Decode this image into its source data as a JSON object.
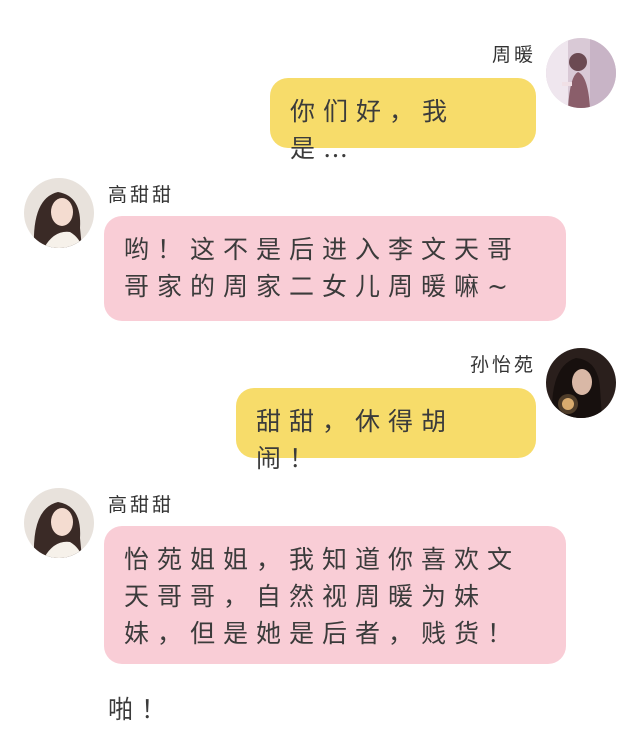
{
  "messages": [
    {
      "sender": "周暖",
      "side": "right",
      "color": "yellow",
      "lines": [
        "你们好，我是…"
      ]
    },
    {
      "sender": "高甜甜",
      "side": "left",
      "color": "pink",
      "lines": [
        "哟！这不是后进入李文天哥",
        "哥家的周家二女儿周暖嘛~"
      ]
    },
    {
      "sender": "孙怡苑",
      "side": "right",
      "color": "yellow",
      "lines": [
        "甜甜，休得胡闹！"
      ]
    },
    {
      "sender": "高甜甜",
      "side": "left",
      "color": "pink",
      "lines": [
        "怡苑姐姐，我知道你喜欢文",
        "天哥哥，自然视周暖为妹",
        "妹，但是她是后者，贱货！"
      ]
    }
  ],
  "narration": "啪！",
  "colors": {
    "yellow_bubble": "#f7dc6a",
    "pink_bubble": "#f9cdd6",
    "background": "#ffffff"
  },
  "avatars": {
    "zhou_nuan": "avatar-zhou-nuan",
    "gao_tiantian": "avatar-gao-tiantian",
    "sun_yiyuan": "avatar-sun-yiyuan"
  }
}
